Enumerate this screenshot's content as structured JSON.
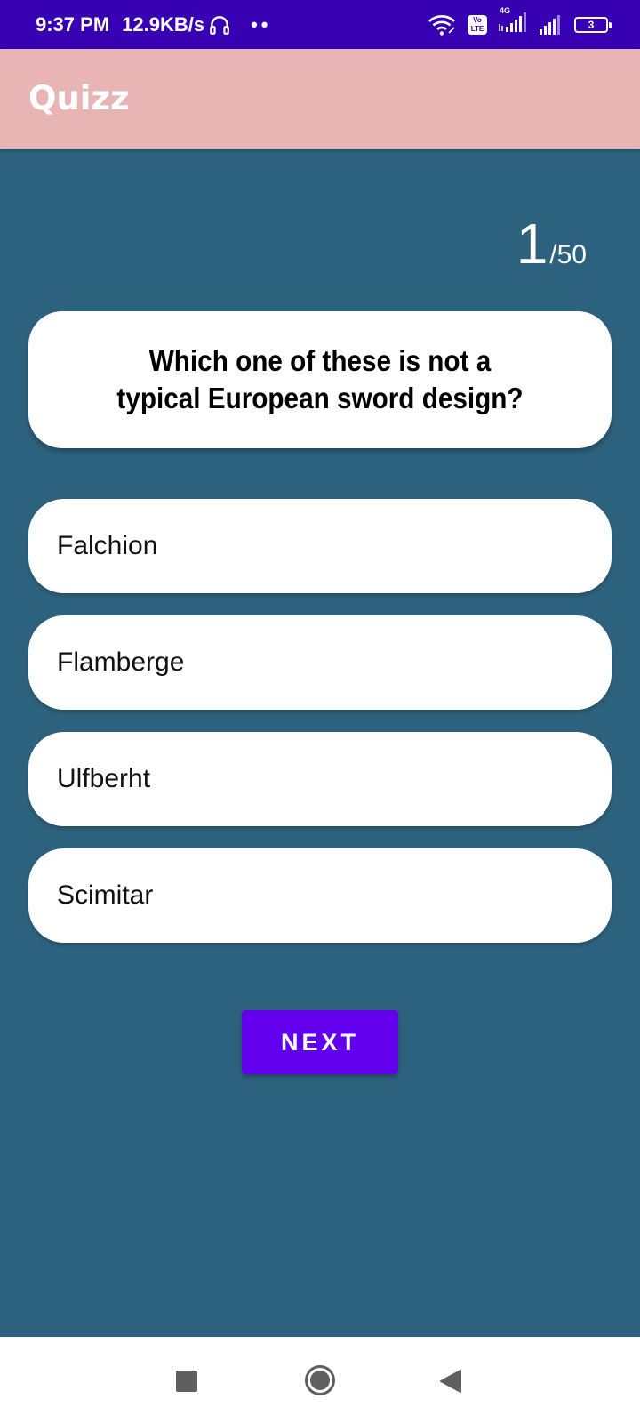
{
  "status_bar": {
    "time": "9:37 PM",
    "speed": "12.9KB/s",
    "dots": "••",
    "volte_top": "Vo",
    "volte_bottom": "LTE",
    "network_type": "4G",
    "battery_level": "3",
    "icons": [
      "headphones-icon",
      "wifi-icon",
      "volte-icon",
      "signal-icon",
      "signal-icon",
      "battery-icon"
    ]
  },
  "app_bar": {
    "title": "Quizz",
    "background_color": "#e8b4b4"
  },
  "quiz": {
    "current_question": "1",
    "total_questions": "/50",
    "question": "Which one of these is not a typical European sword design?",
    "options": [
      {
        "label": "Falchion"
      },
      {
        "label": "Flamberge"
      },
      {
        "label": "Ulfberht"
      },
      {
        "label": "Scimitar"
      }
    ],
    "next_label": "NEXT",
    "accent_color": "#6200ee",
    "background_color": "#2d627e"
  },
  "nav_bar": {
    "icons": [
      "recent-apps-icon",
      "home-icon",
      "back-icon"
    ]
  }
}
